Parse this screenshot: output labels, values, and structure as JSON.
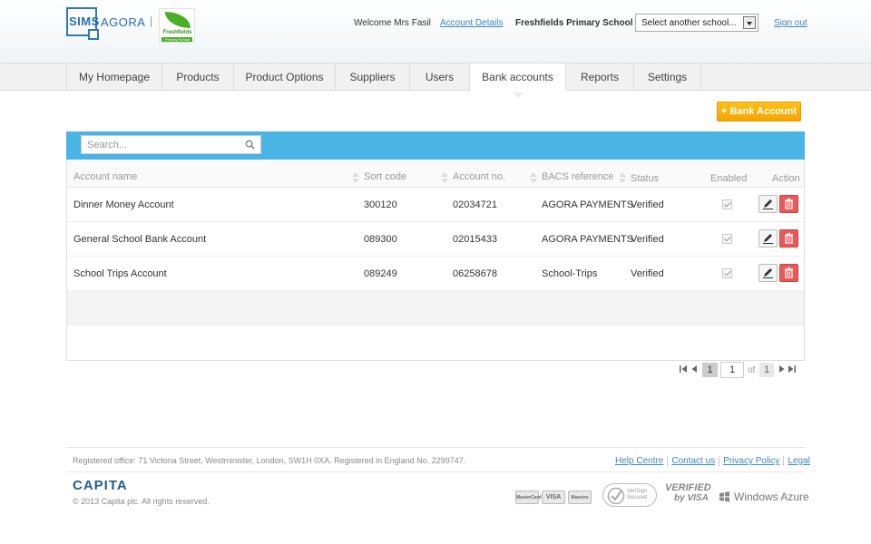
{
  "header": {
    "sims": "SIMS",
    "agora": "AGORA",
    "school_logo_name": "Freshfields",
    "school_logo_sub": "Primary School",
    "welcome": "Welcome Mrs Fasil",
    "account_details": "Account Details",
    "school_name": "Freshfields Primary School",
    "school_select": "Select another school...",
    "sign_out": "Sign out"
  },
  "nav": {
    "tabs": [
      {
        "label": "My Homepage"
      },
      {
        "label": "Products"
      },
      {
        "label": "Product Options"
      },
      {
        "label": "Suppliers"
      },
      {
        "label": "Users"
      },
      {
        "label": "Bank accounts"
      },
      {
        "label": "Reports"
      },
      {
        "label": "Settings"
      }
    ],
    "active": "Bank accounts"
  },
  "main": {
    "add_button": "+ Bank Account",
    "search_placeholder": "Search...",
    "columns": {
      "name": "Account name",
      "sort_code": "Sort code",
      "account_no": "Account no.",
      "bacs": "BACS reference",
      "status": "Status",
      "enabled": "Enabled",
      "action": "Action"
    },
    "rows": [
      {
        "name": "Dinner Money Account",
        "sort_code": "300120",
        "account_no": "02034721",
        "bacs": "AGORA PAYMENTS",
        "status": "Verified",
        "enabled": true
      },
      {
        "name": "General School Bank Account",
        "sort_code": "089300",
        "account_no": "02015433",
        "bacs": "AGORA PAYMENTS",
        "status": "Verified",
        "enabled": true
      },
      {
        "name": "School Trips Account",
        "sort_code": "089249",
        "account_no": "06258678",
        "bacs": "School-Trips",
        "status": "Verified",
        "enabled": true
      }
    ],
    "pager": {
      "current": "1",
      "input": "1",
      "of": "of",
      "total": "1"
    }
  },
  "footer": {
    "registered_office": "Registered office: 71 Victoria Street, Westminister, London, SW1H 0XA. Registered in England No. 2299747.",
    "links": [
      "Help Centre",
      "Contact us",
      "Privacy Policy",
      "Legal"
    ],
    "capita": "CAPITA",
    "copyright": "© 2013 Capita plc. All rights reserved.",
    "cards": [
      "MasterCard",
      "VISA",
      "Maestro"
    ],
    "verisign": "VeriSign Secured",
    "verified_visa_1": "VERIFIED",
    "verified_visa_2": "by VISA",
    "azure": "Windows Azure"
  },
  "colors": {
    "toolbar": "#4ab4e4",
    "add_button": "#f4a300",
    "link": "#3b88c3",
    "delete": "#e85a5a",
    "brand": "#2a6fa8"
  }
}
